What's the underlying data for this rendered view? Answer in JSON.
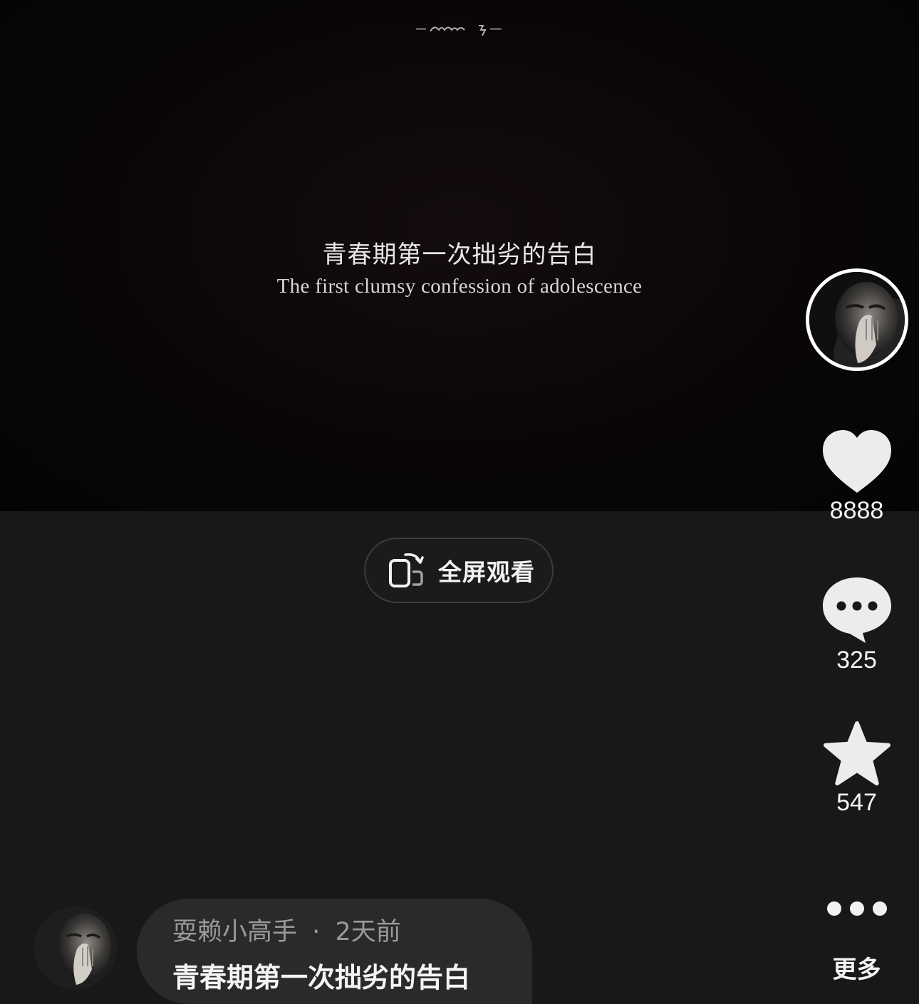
{
  "video": {
    "subtitle_cn": "青春期第一次拙劣的告白",
    "subtitle_en": "The first clumsy confession of adolescence"
  },
  "fullscreen": {
    "label": "全屏观看",
    "icon": "rotate-phone-icon"
  },
  "actions": {
    "like": {
      "count": "8888",
      "icon": "heart-icon"
    },
    "comment": {
      "count": "325",
      "icon": "comment-bubble-icon"
    },
    "favorite": {
      "count": "547",
      "icon": "star-icon"
    },
    "more": {
      "label": "更多",
      "icon": "ellipsis-icon"
    }
  },
  "post": {
    "author": "耍赖小高手",
    "separator": "·",
    "time": "2天前",
    "title": "青春期第一次拙劣的告白"
  },
  "colors": {
    "page_bg": "#181818",
    "video_bg": "#0a0607",
    "caption_bg": "#2a2a2a",
    "text_primary": "#f4f4f4",
    "text_muted": "#9a9a9a"
  }
}
